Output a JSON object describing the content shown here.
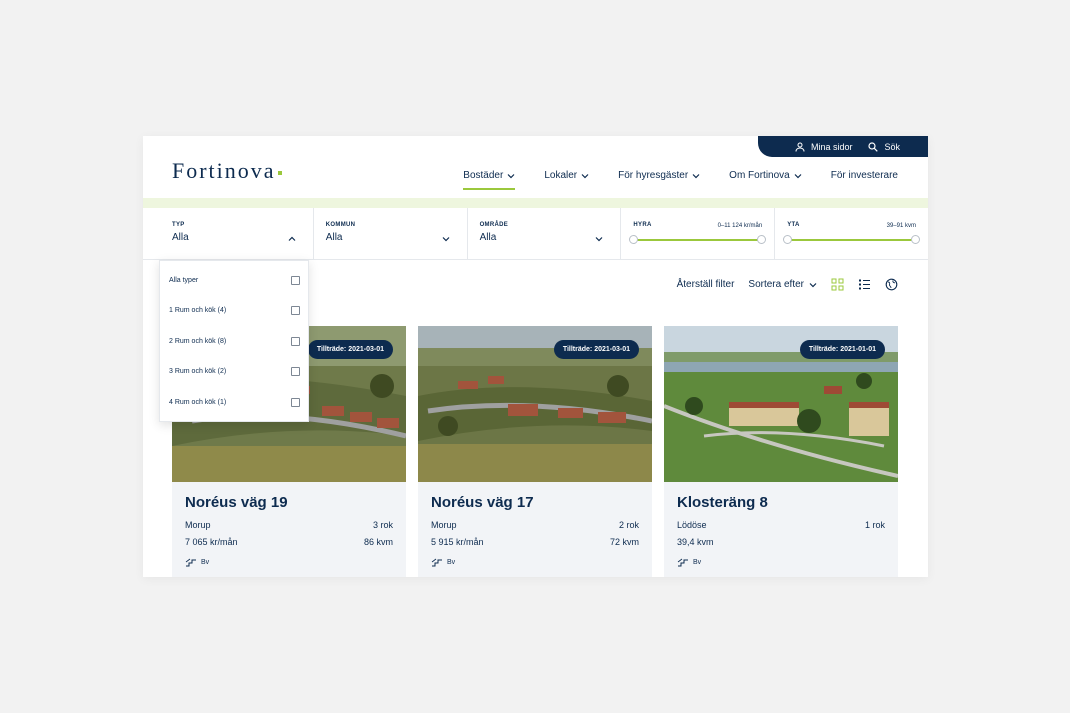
{
  "header": {
    "logo": "Fortinova",
    "util": {
      "my_pages": "Mina sidor",
      "search": "Sök"
    },
    "nav": [
      "Bostäder",
      "Lokaler",
      "För hyresgäster",
      "Om Fortinova",
      "För investerare"
    ]
  },
  "filters": {
    "typ": {
      "label": "TYP",
      "value": "Alla"
    },
    "kommun": {
      "label": "KOMMUN",
      "value": "Alla"
    },
    "omrade": {
      "label": "OMRÅDE",
      "value": "Alla"
    },
    "hyra": {
      "label": "HYRA",
      "range": "0–11 124 kr/mån"
    },
    "yta": {
      "label": "YTA",
      "range": "39–91 kvm"
    }
  },
  "dropdown": {
    "options": [
      "Alla typer",
      "1 Rum och kök (4)",
      "2 Rum och kök (8)",
      "3 Rum och kök (2)",
      "4 Rum och kök (1)"
    ]
  },
  "toolbar": {
    "reset": "Återställ filter",
    "sort": "Sortera efter"
  },
  "cards": [
    {
      "badge": "Tillträde: 2021-03-01",
      "title": "Noréus väg 19",
      "town": "Morup",
      "rooms": "3 rok",
      "rent": "7 065 kr/mån",
      "size": "86 kvm",
      "energy": "Bv"
    },
    {
      "badge": "Tillträde: 2021-03-01",
      "title": "Noréus väg 17",
      "town": "Morup",
      "rooms": "2 rok",
      "rent": "5 915 kr/mån",
      "size": "72 kvm",
      "energy": "Bv"
    },
    {
      "badge": "Tillträde: 2021-01-01",
      "title": "Klosteräng 8",
      "town": "Lödöse",
      "rooms": "1 rok",
      "rent": "39,4 kvm",
      "size": "",
      "energy": "Bv"
    }
  ],
  "colors": {
    "navy": "#0d2b4f",
    "accent": "#9bc83c"
  }
}
